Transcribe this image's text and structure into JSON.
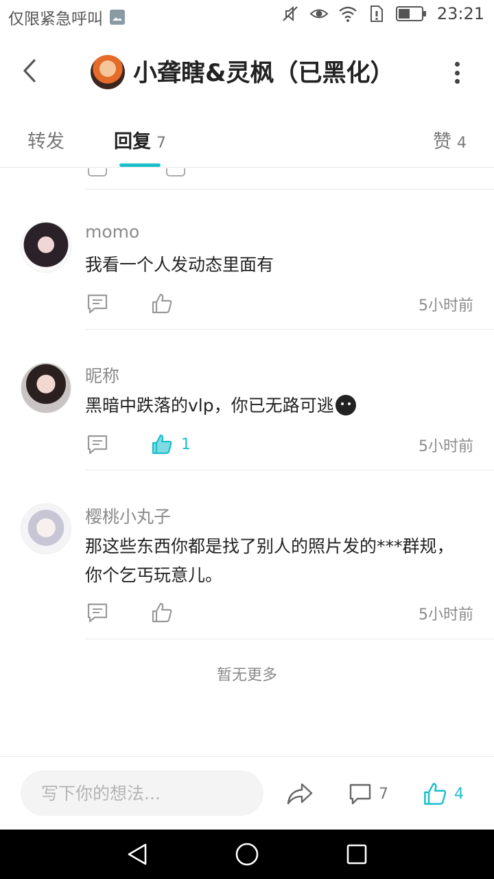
{
  "status_bar": {
    "carrier_text": "仅限紧急呼叫",
    "time": "23:21",
    "icons": [
      "image-notification-icon",
      "mute-icon",
      "eye-icon",
      "wifi-icon",
      "sim-alert-icon",
      "battery-icon"
    ]
  },
  "header": {
    "title": "小聋瞎&灵枫（已黑化）",
    "back_icon": "chevron-left-icon",
    "more_icon": "more-vertical-icon"
  },
  "tabs": [
    {
      "label": "转发",
      "count": ""
    },
    {
      "label": "回复",
      "count": "7",
      "active": true
    },
    {
      "label": "赞",
      "count": "4"
    }
  ],
  "comments": [
    {
      "name": "momo",
      "text": "我看一个人发动态里面有",
      "time": "5小时前",
      "likes": ""
    },
    {
      "name": "昵称",
      "text": "黑暗中跌落的vlp，你已无路可逃",
      "time": "5小时前",
      "likes": "1",
      "liked": true
    },
    {
      "name": "樱桃小丸子",
      "text": "那这些东西你都是找了别人的照片发的***群规，你个乞丐玩意儿。",
      "time": "5小时前",
      "likes": ""
    }
  ],
  "list_footer": "暂无更多",
  "bottom_bar": {
    "input_placeholder": "写下你的想法...",
    "comment_count": "7",
    "like_count": "4"
  },
  "colors": {
    "accent": "#1bbecb",
    "text_primary": "#222222",
    "text_secondary": "#8a8a8a",
    "divider": "#e8e8e8"
  }
}
